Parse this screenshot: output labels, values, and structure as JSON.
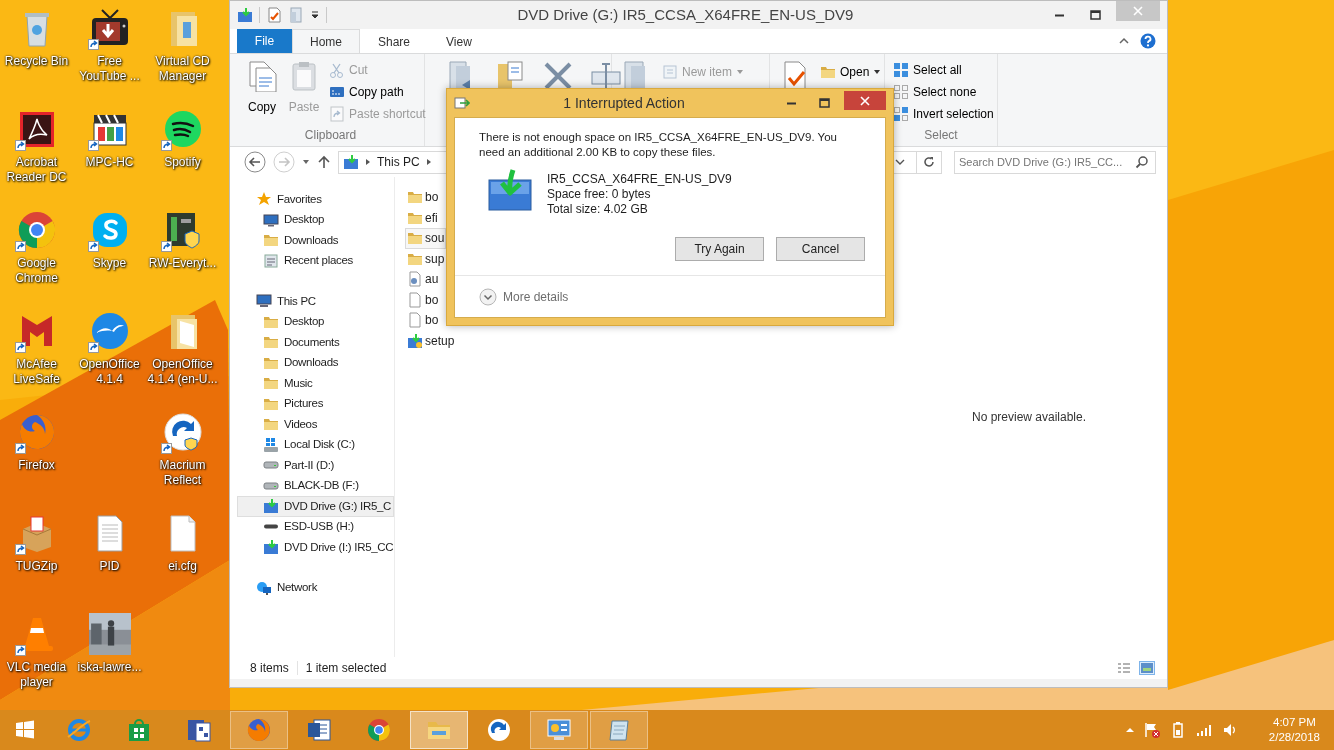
{
  "desktop": {
    "icons": [
      {
        "label": "Recycle Bin",
        "shortcut": false
      },
      {
        "label": "Free YouTube ...",
        "shortcut": true
      },
      {
        "label": "Virtual CD Manager",
        "shortcut": false
      },
      {
        "label": "Acrobat Reader DC",
        "shortcut": true
      },
      {
        "label": "MPC-HC",
        "shortcut": true
      },
      {
        "label": "Spotify",
        "shortcut": true
      },
      {
        "label": "Google Chrome",
        "shortcut": true
      },
      {
        "label": "Skype",
        "shortcut": true
      },
      {
        "label": "RW-Everyt...",
        "shortcut": true
      },
      {
        "label": "McAfee LiveSafe",
        "shortcut": true
      },
      {
        "label": "OpenOffice 4.1.4",
        "shortcut": true
      },
      {
        "label": "OpenOffice 4.1.4 (en-U...",
        "shortcut": false
      },
      {
        "label": "Firefox",
        "shortcut": true
      },
      {
        "label": "Macrium Reflect",
        "shortcut": true
      },
      {
        "label": "TUGZip",
        "shortcut": true
      },
      {
        "label": "PID",
        "shortcut": false
      },
      {
        "label": "ei.cfg",
        "shortcut": false
      },
      {
        "label": "VLC media player",
        "shortcut": true
      },
      {
        "label": "iska-lawre...",
        "shortcut": false,
        "kind": "picture"
      }
    ]
  },
  "explorer": {
    "title": "DVD Drive (G:) IR5_CCSA_X64FRE_EN-US_DV9",
    "file_menu": "File",
    "tabs": [
      {
        "label": "Home",
        "selected": true
      },
      {
        "label": "Share",
        "selected": false
      },
      {
        "label": "View",
        "selected": false
      }
    ],
    "ribbon": {
      "clipboard": {
        "large": [
          {
            "label": "Copy",
            "disabled": false
          },
          {
            "label": "Paste",
            "disabled": true
          }
        ],
        "small": [
          {
            "label": "Cut",
            "disabled": true
          },
          {
            "label": "Copy path",
            "disabled": false
          },
          {
            "label": "Paste shortcut",
            "disabled": true
          }
        ],
        "group_label": "Clipboard"
      },
      "new_item": {
        "label": "New item",
        "disabled": true
      },
      "open": {
        "label": "Open",
        "disabled": false
      },
      "select": {
        "items": [
          "Select all",
          "Select none",
          "Invert selection"
        ],
        "group_label": "Select"
      }
    },
    "address": {
      "crumbs": [
        "This PC"
      ]
    },
    "search": {
      "placeholder": "Search DVD Drive (G:) IR5_CC..."
    },
    "nav": [
      {
        "label": "Favorites",
        "kind": "star",
        "selected": false,
        "children": [
          {
            "label": "Desktop",
            "kind": "desktop",
            "selected": false
          },
          {
            "label": "Downloads",
            "kind": "folder",
            "selected": false
          },
          {
            "label": "Recent places",
            "kind": "recent",
            "selected": false
          }
        ]
      },
      {
        "label": "This PC",
        "kind": "pc",
        "selected": false,
        "children": [
          {
            "label": "Desktop",
            "kind": "folder",
            "selected": false
          },
          {
            "label": "Documents",
            "kind": "folder",
            "selected": false
          },
          {
            "label": "Downloads",
            "kind": "folder",
            "selected": false
          },
          {
            "label": "Music",
            "kind": "folder",
            "selected": false
          },
          {
            "label": "Pictures",
            "kind": "folder",
            "selected": false
          },
          {
            "label": "Videos",
            "kind": "folder",
            "selected": false
          },
          {
            "label": "Local Disk (C:)",
            "kind": "system-disk",
            "selected": false
          },
          {
            "label": "Part-II (D:)",
            "kind": "disk",
            "selected": false
          },
          {
            "label": "BLACK-DB (F:)",
            "kind": "disk",
            "selected": false
          },
          {
            "label": "DVD Drive (G:) IR5_C",
            "kind": "dvd",
            "selected": true
          },
          {
            "label": "ESD-USB (H:)",
            "kind": "usb",
            "selected": false
          },
          {
            "label": "DVD Drive (I:) IR5_CC",
            "kind": "dvd",
            "selected": false
          }
        ]
      },
      {
        "label": "Network",
        "kind": "network",
        "selected": false
      }
    ],
    "files": [
      {
        "name": "bo",
        "kind": "folder",
        "selected": false
      },
      {
        "name": "efi",
        "kind": "folder",
        "selected": false
      },
      {
        "name": "sou",
        "kind": "folder",
        "selected": true
      },
      {
        "name": "sup",
        "kind": "folder",
        "selected": false
      },
      {
        "name": "au",
        "kind": "settings",
        "selected": false
      },
      {
        "name": "bo",
        "kind": "file",
        "selected": false
      },
      {
        "name": "bo",
        "kind": "file",
        "selected": false
      },
      {
        "name": "setup",
        "kind": "app",
        "selected": false
      }
    ],
    "preview": "No preview available.",
    "status": [
      "8 items",
      "1 item selected"
    ]
  },
  "dialog": {
    "title": "1 Interrupted Action",
    "message": "There is not enough space on IR5_CCSA_X64FRE_EN-US_DV9. You need an additional 2.00 KB to copy these files.",
    "drive_name": "IR5_CCSA_X64FRE_EN-US_DV9",
    "details": [
      "Space free: 0 bytes",
      "Total size: 4.02 GB"
    ],
    "buttons": [
      "Try Again",
      "Cancel"
    ],
    "more_details": "More details"
  },
  "taskbar": {
    "items": [
      {
        "open": false,
        "active": false
      },
      {
        "open": false,
        "active": false
      },
      {
        "open": false,
        "active": false
      },
      {
        "open": true,
        "active": false
      },
      {
        "open": false,
        "active": false
      },
      {
        "open": false,
        "active": false
      },
      {
        "open": true,
        "active": true
      },
      {
        "open": false,
        "active": false
      },
      {
        "open": true,
        "active": false
      },
      {
        "open": true,
        "active": false
      }
    ],
    "time": "4:07 PM",
    "date": "2/28/2018"
  }
}
